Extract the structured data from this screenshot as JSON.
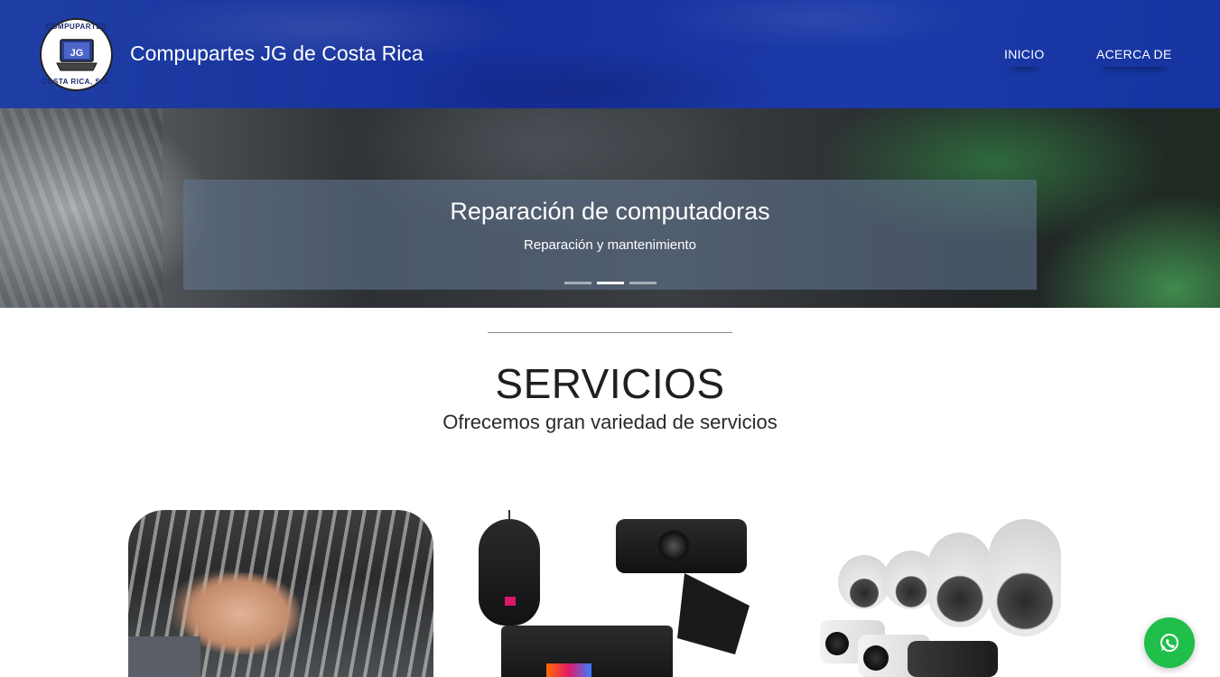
{
  "header": {
    "logo": {
      "ring_top": "COMPUPARTES",
      "ring_bottom": "COSTA RICA, S.A.",
      "initials": "JG"
    },
    "site_title": "Compupartes JG de Costa Rica",
    "nav": [
      {
        "label": "INICIO"
      },
      {
        "label": "ACERCA DE"
      }
    ]
  },
  "hero": {
    "slide_title": "Reparación de computadoras",
    "slide_subtitle": "Reparación y mantenimiento",
    "indicator_count": 3,
    "active_indicator": 2
  },
  "services": {
    "title": "SERVICIOS",
    "subtitle": "Ofrecemos gran variedad de servicios",
    "cards": [
      {
        "image": "network-cabling-photo"
      },
      {
        "image": "peripherals-photo"
      },
      {
        "image": "security-cameras-photo"
      }
    ]
  },
  "colors": {
    "header_blue": "#1b3aa8",
    "whatsapp_green": "#1fbf4a"
  },
  "icons": {
    "whatsapp": "whatsapp-icon"
  }
}
